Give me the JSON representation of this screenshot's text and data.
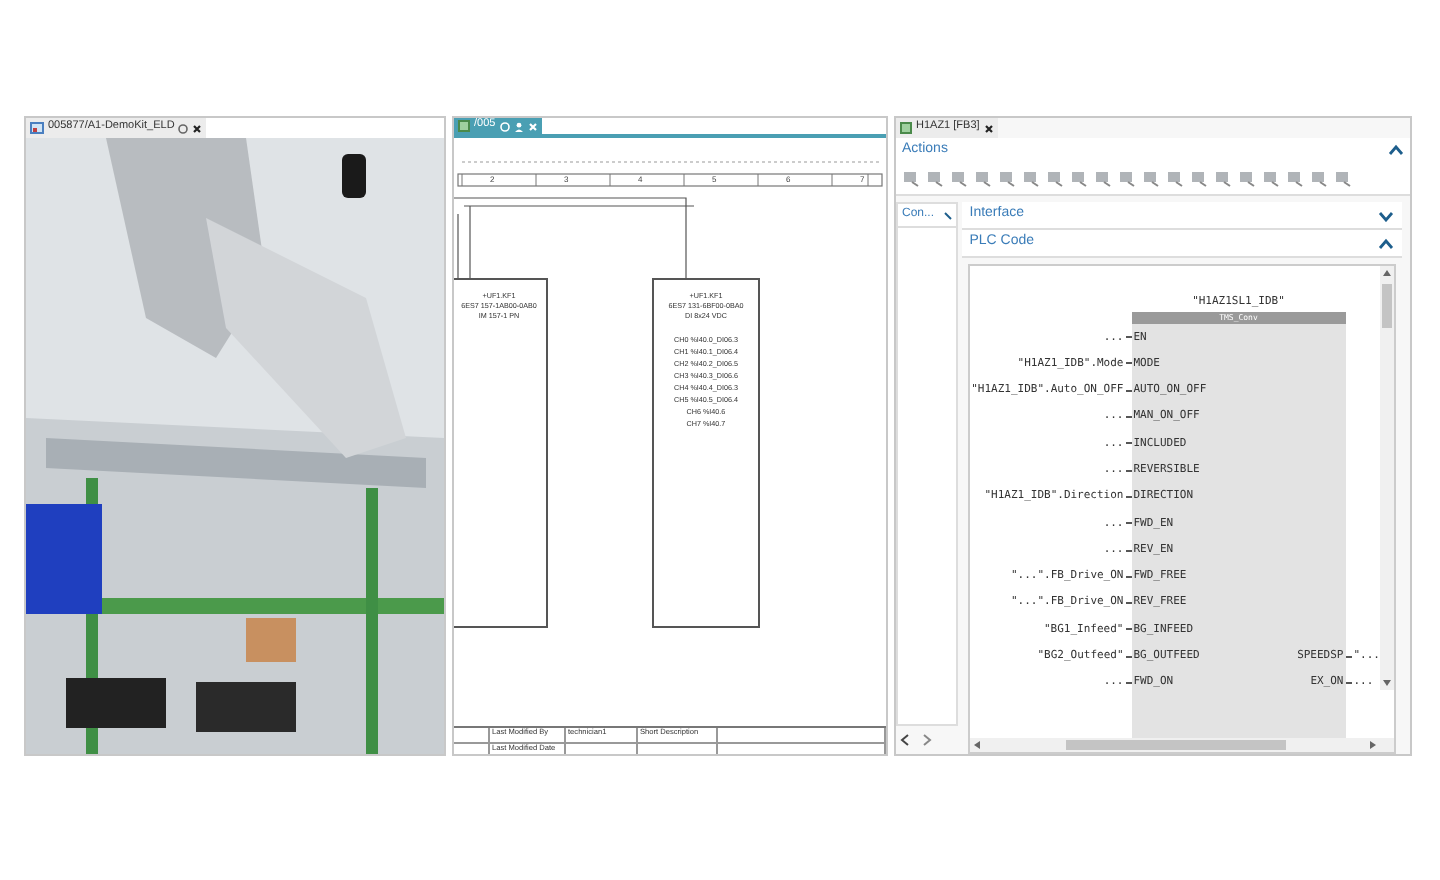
{
  "left_panel": {
    "tab": {
      "title": "005877/A1-DemoKit_ELD",
      "selected": false
    }
  },
  "schematic_panel": {
    "tab": {
      "title": "/005",
      "selected": true
    },
    "columns": [
      "2",
      "3",
      "4",
      "5",
      "6",
      "7"
    ],
    "modules": [
      {
        "lines": [
          "+UF1.KF1",
          "6ES7 157-1AB00-0AB0",
          "IM 157-1 PN"
        ]
      },
      {
        "lines": [
          "+UF1.KF1",
          "6ES7 131-6BF00-0BA0",
          "DI 8x24 VDC"
        ],
        "channels": [
          "CH0 %I40.0_DI06.3",
          "CH1 %I40.1_DI06.4",
          "CH2 %I40.2_DI06.5",
          "CH3 %I40.3_DI06.6",
          "CH4 %I40.4_DI06.3",
          "CH5 %I40.5_DI06.4",
          "CH6 %I40.6",
          "CH7 %I40.7"
        ]
      }
    ],
    "title_block": {
      "modified_by_label": "Last Modified By",
      "modified_by": "technician1",
      "description_label": "Short Description",
      "modified_date_label": "Last Modified Date"
    }
  },
  "fb_panel": {
    "tab": {
      "title": "H1AZ1 [FB3]",
      "selected": false
    },
    "actions": {
      "title": "Actions",
      "expanded": true
    },
    "side_tab": "Con...",
    "sections": [
      {
        "title": "Interface",
        "expanded": false
      },
      {
        "title": "PLC Code",
        "expanded": true
      }
    ],
    "block": {
      "instance": "\"H1AZ1SL1_IDB\"",
      "type": "TMS_Conv",
      "rows": [
        {
          "param": "...",
          "pin": "EN"
        },
        {
          "param": "\"H1AZ1_IDB\".Mode",
          "pin": "MODE"
        },
        {
          "param": "\"H1AZ1_IDB\".Auto_ON_OFF",
          "pin": "AUTO_ON_OFF"
        },
        {
          "param": "...",
          "pin": "MAN_ON_OFF"
        },
        {
          "param": "...",
          "pin": "INCLUDED"
        },
        {
          "param": "...",
          "pin": "REVERSIBLE"
        },
        {
          "param": "\"H1AZ1_IDB\".Direction",
          "pin": "DIRECTION"
        },
        {
          "param": "...",
          "pin": "FWD_EN"
        },
        {
          "param": "...",
          "pin": "REV_EN"
        },
        {
          "param": "\"...\".FB_Drive_ON",
          "pin": "FWD_FREE"
        },
        {
          "param": "\"...\".FB_Drive_ON",
          "pin": "REV_FREE"
        },
        {
          "param": "\"BG1_Infeed\"",
          "pin": "BG_INFEED"
        },
        {
          "param": "\"BG2_Outfeed\"",
          "pin": "BG_OUTFEED",
          "out_pin": "SPEEDSP",
          "out_param": "\"..."
        },
        {
          "param": "...",
          "pin": "FWD_ON",
          "out_pin": "EX_ON",
          "out_param": "..."
        }
      ]
    }
  }
}
